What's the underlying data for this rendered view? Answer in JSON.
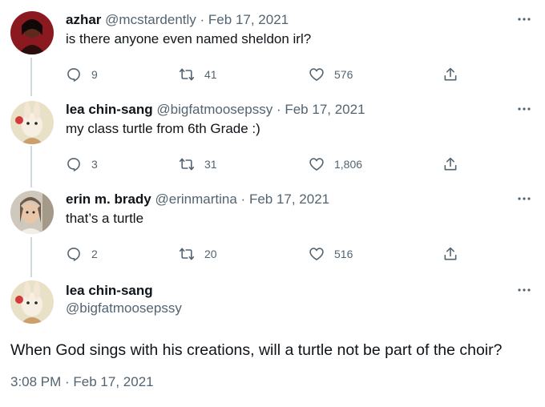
{
  "tweets": [
    {
      "name": "azhar",
      "handle": "@mcstardently",
      "sep": "·",
      "date": "Feb 17, 2021",
      "text": "is there anyone even named sheldon irl?",
      "replies": "9",
      "retweets": "41",
      "likes": "576"
    },
    {
      "name": "lea chin-sang",
      "handle": "@bigfatmoosepssy",
      "sep": "·",
      "date": "Feb 17, 2021",
      "text": "my class turtle from 6th Grade :)",
      "replies": "3",
      "retweets": "31",
      "likes": "1,806"
    },
    {
      "name": "erin m. brady",
      "handle": "@erinmartina",
      "sep": "·",
      "date": "Feb 17, 2021",
      "text": "that’s a turtle",
      "replies": "2",
      "retweets": "20",
      "likes": "516"
    }
  ],
  "main": {
    "name": "lea chin-sang",
    "handle": "@bigfatmoosepssy",
    "text": "When God sings with his creations, will a turtle not be part of the choir?",
    "timestamp": "3:08 PM · Feb 17, 2021"
  },
  "icons": {
    "reply": "reply-icon",
    "retweet": "retweet-icon",
    "like": "heart-icon",
    "share": "share-icon",
    "more": "more-icon"
  },
  "colors": {
    "text": "#0f1419",
    "secondary": "#536471",
    "thread_line": "#cfd9de"
  }
}
